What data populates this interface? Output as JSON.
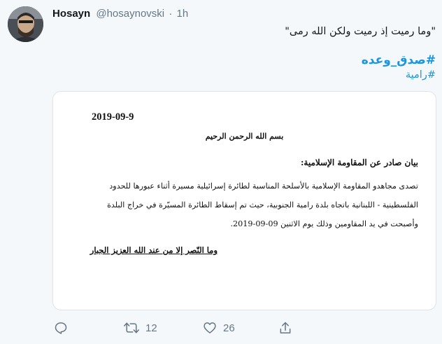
{
  "user": {
    "name": "Hosayn",
    "handle": "@hosaynovski",
    "separator": "·",
    "time": "1h"
  },
  "tweet": {
    "text": "\"وما رميت إذ رميت ولكن الله رمى\"",
    "hashtags": [
      "#صدق_وعده",
      "#رامية"
    ]
  },
  "media": {
    "date": "2019-09-9",
    "basmala": "بسم الله الرحمن الرحيم",
    "heading": "بيان صادر عن المقاومة الإسلامية:",
    "body_lines": [
      "تصدى مجاهدو المقاومة الإسلامية بالأسلحة المناسبة لطائرة إسرائيلية مسيرة أثناء عبورها للحدود",
      "الفلسطينية - اللبنانية باتجاه بلدة رامية الجنوبية، حيث تم إسقاط الطائرة المسيّرة في خراج البلدة",
      "وأصبحت في يد المقاومين وذلك يوم الاثنين 09-09-2019."
    ],
    "closing": "وما النّصر إلا من عند الله العزيز الجبار"
  },
  "actions": {
    "reply_icon": "reply-icon",
    "retweet_icon": "retweet-icon",
    "retweet_count": "12",
    "like_icon": "heart-icon",
    "like_count": "26",
    "share_icon": "share-icon"
  },
  "colors": {
    "background": "#f5f8fa",
    "link": "#1b95e0",
    "muted": "#657786"
  }
}
